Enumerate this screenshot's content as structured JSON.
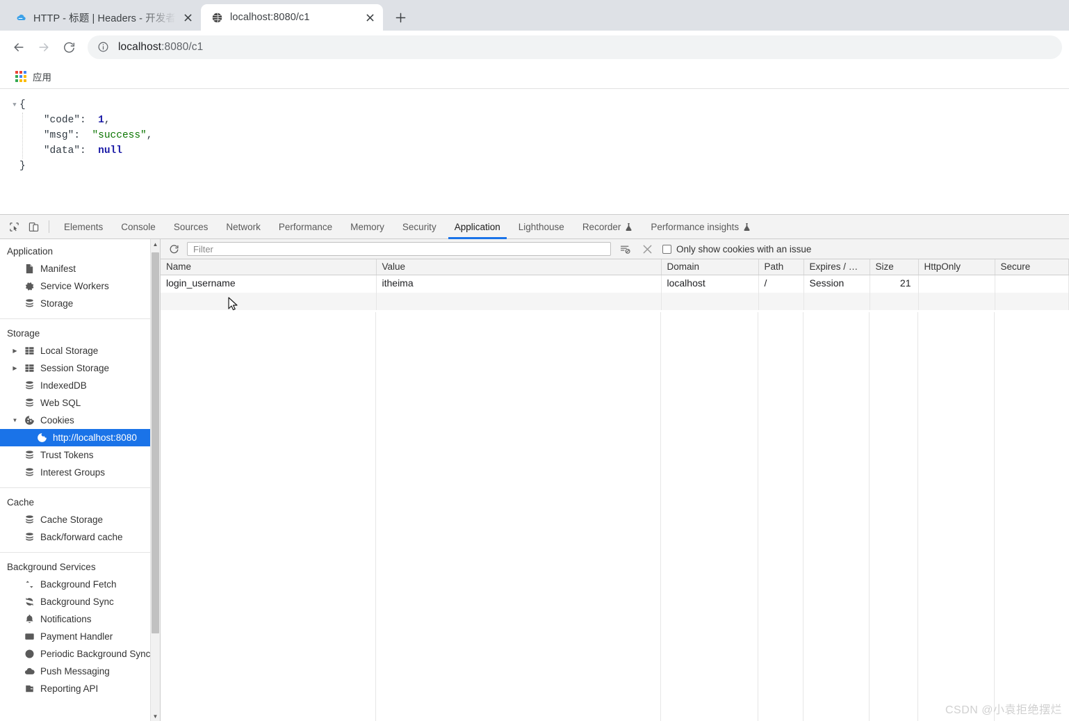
{
  "browser": {
    "tabs": [
      {
        "title": "HTTP - 标题 | Headers - 开发者",
        "favicon": "cloud-icon",
        "active": false
      },
      {
        "title": "localhost:8080/c1",
        "favicon": "globe-icon",
        "active": true
      }
    ],
    "new_tab_label": "+",
    "nav": {
      "back": "back-arrow",
      "forward": "forward-arrow",
      "reload": "reload-icon"
    },
    "omnibox": {
      "url_host": "localhost",
      "url_path": ":8080/c1",
      "full_url": "localhost:8080/c1",
      "info_icon": "site-info-icon"
    },
    "bookmarks": [
      {
        "label": "应用",
        "icon": "apps-grid-icon"
      }
    ]
  },
  "page": {
    "json_lines": [
      {
        "indent": 0,
        "twisty": "▼",
        "text": "{"
      },
      {
        "indent": 1,
        "key": "\"code\"",
        "value": "1",
        "value_type": "num",
        "comma": ","
      },
      {
        "indent": 1,
        "key": "\"msg\"",
        "value": "\"success\"",
        "value_type": "str",
        "comma": ","
      },
      {
        "indent": 1,
        "key": "\"data\"",
        "value": "null",
        "value_type": "null",
        "comma": ""
      },
      {
        "indent": 0,
        "text": "}"
      }
    ],
    "brace_open": "{",
    "brace_close": "}",
    "code_key": "\"code\"",
    "code_value": "1",
    "code_comma": ",",
    "msg_key": "\"msg\"",
    "msg_value": "\"success\"",
    "msg_comma": ",",
    "data_key": "\"data\"",
    "data_value": "null",
    "colon": ":",
    "twisty": "▼"
  },
  "devtools": {
    "left_icons": [
      {
        "name": "inspect-element-icon"
      },
      {
        "name": "device-toolbar-icon"
      }
    ],
    "tabs": [
      {
        "label": "Elements",
        "selected": false,
        "experimental": false
      },
      {
        "label": "Console",
        "selected": false,
        "experimental": false
      },
      {
        "label": "Sources",
        "selected": false,
        "experimental": false
      },
      {
        "label": "Network",
        "selected": false,
        "experimental": false
      },
      {
        "label": "Performance",
        "selected": false,
        "experimental": false
      },
      {
        "label": "Memory",
        "selected": false,
        "experimental": false
      },
      {
        "label": "Security",
        "selected": false,
        "experimental": false
      },
      {
        "label": "Application",
        "selected": true,
        "experimental": false
      },
      {
        "label": "Lighthouse",
        "selected": false,
        "experimental": false
      },
      {
        "label": "Recorder",
        "selected": false,
        "experimental": true
      },
      {
        "label": "Performance insights",
        "selected": false,
        "experimental": true
      }
    ],
    "sidebar": {
      "groups": [
        {
          "title": "Application",
          "items": [
            {
              "label": "Manifest",
              "icon": "document-icon",
              "arrow": "",
              "selected": false,
              "child": false
            },
            {
              "label": "Service Workers",
              "icon": "gear-icon",
              "arrow": "",
              "selected": false,
              "child": false
            },
            {
              "label": "Storage",
              "icon": "database-icon",
              "arrow": "",
              "selected": false,
              "child": false
            }
          ]
        },
        {
          "title": "Storage",
          "items": [
            {
              "label": "Local Storage",
              "icon": "table-icon",
              "arrow": "▶",
              "selected": false,
              "child": false
            },
            {
              "label": "Session Storage",
              "icon": "table-icon",
              "arrow": "▶",
              "selected": false,
              "child": false
            },
            {
              "label": "IndexedDB",
              "icon": "database-icon",
              "arrow": "",
              "selected": false,
              "child": false
            },
            {
              "label": "Web SQL",
              "icon": "database-icon",
              "arrow": "",
              "selected": false,
              "child": false
            },
            {
              "label": "Cookies",
              "icon": "cookie-icon",
              "arrow": "▼",
              "selected": false,
              "child": false
            },
            {
              "label": "http://localhost:8080",
              "icon": "cookie-icon",
              "arrow": "",
              "selected": true,
              "child": true
            },
            {
              "label": "Trust Tokens",
              "icon": "database-icon",
              "arrow": "",
              "selected": false,
              "child": false
            },
            {
              "label": "Interest Groups",
              "icon": "database-icon",
              "arrow": "",
              "selected": false,
              "child": false
            }
          ]
        },
        {
          "title": "Cache",
          "items": [
            {
              "label": "Cache Storage",
              "icon": "database-icon",
              "arrow": "",
              "selected": false,
              "child": false
            },
            {
              "label": "Back/forward cache",
              "icon": "database-icon",
              "arrow": "",
              "selected": false,
              "child": false
            }
          ]
        },
        {
          "title": "Background Services",
          "items": [
            {
              "label": "Background Fetch",
              "icon": "updown-arrows-icon",
              "arrow": "",
              "selected": false,
              "child": false
            },
            {
              "label": "Background Sync",
              "icon": "sync-icon",
              "arrow": "",
              "selected": false,
              "child": false
            },
            {
              "label": "Notifications",
              "icon": "bell-icon",
              "arrow": "",
              "selected": false,
              "child": false
            },
            {
              "label": "Payment Handler",
              "icon": "credit-card-icon",
              "arrow": "",
              "selected": false,
              "child": false
            },
            {
              "label": "Periodic Background Sync",
              "icon": "clock-icon",
              "arrow": "",
              "selected": false,
              "child": false
            },
            {
              "label": "Push Messaging",
              "icon": "cloud-icon",
              "arrow": "",
              "selected": false,
              "child": false
            },
            {
              "label": "Reporting API",
              "icon": "report-icon",
              "arrow": "",
              "selected": false,
              "child": false
            }
          ]
        }
      ]
    },
    "cookies_toolbar": {
      "refresh_icon": "refresh-icon",
      "filter_placeholder": "Filter",
      "filter_value": "",
      "clear_filtered_icon": "clear-filtered-cookies-icon",
      "clear_all_icon": "clear-all-cookies-icon",
      "issue_checkbox_label": "Only show cookies with an issue",
      "issue_checkbox_checked": false
    },
    "cookies_table": {
      "columns": [
        "Name",
        "Value",
        "Domain",
        "Path",
        "Expires / …",
        "Size",
        "HttpOnly",
        "Secure"
      ],
      "rows": [
        {
          "Name": "login_username",
          "Value": "itheima",
          "Domain": "localhost",
          "Path": "/",
          "Expires / …": "Session",
          "Size": "21",
          "HttpOnly": "",
          "Secure": ""
        }
      ]
    }
  },
  "watermark": "CSDN @小袁拒绝摆烂",
  "colors": {
    "accent": "#1a73e8",
    "tabstrip_bg": "#dee1e6",
    "devtools_bg": "#f3f3f3",
    "json_string": "#0b7500",
    "json_number": "#1a1aa6"
  }
}
